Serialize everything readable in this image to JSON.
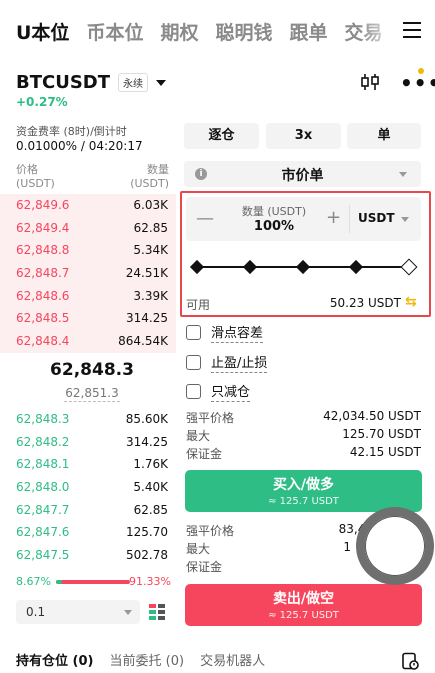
{
  "top_tabs": [
    "U本位",
    "币本位",
    "期权",
    "聪明钱",
    "跟单",
    "交易"
  ],
  "header": {
    "symbol": "BTCUSDT",
    "perp_tag": "永续",
    "change": "+0.27%"
  },
  "funding": {
    "label": "资金费率 (8时)/倒计时",
    "value": "0.01000% / 04:20:17"
  },
  "orderbook": {
    "col_price": "价格",
    "col_price_unit": "(USDT)",
    "col_qty": "数量",
    "col_qty_unit": "(USDT)",
    "asks": [
      {
        "price": "62,849.6",
        "qty": "6.03K"
      },
      {
        "price": "62,849.4",
        "qty": "62.85"
      },
      {
        "price": "62,848.8",
        "qty": "5.34K"
      },
      {
        "price": "62,848.7",
        "qty": "24.51K"
      },
      {
        "price": "62,848.6",
        "qty": "3.39K"
      },
      {
        "price": "62,848.5",
        "qty": "314.25"
      },
      {
        "price": "62,848.4",
        "qty": "864.54K"
      }
    ],
    "last_price": "62,848.3",
    "mark_price": "62,851.3",
    "bids": [
      {
        "price": "62,848.3",
        "qty": "85.60K"
      },
      {
        "price": "62,848.2",
        "qty": "314.25"
      },
      {
        "price": "62,848.1",
        "qty": "1.76K"
      },
      {
        "price": "62,848.0",
        "qty": "5.40K"
      },
      {
        "price": "62,847.7",
        "qty": "62.85"
      },
      {
        "price": "62,847.6",
        "qty": "125.70"
      },
      {
        "price": "62,847.5",
        "qty": "502.78"
      }
    ],
    "buy_ratio": "8.67%",
    "sell_ratio": "91.33%",
    "buy_ratio_value": 0.0867,
    "depth": "0.1"
  },
  "order_panel": {
    "margin_mode": "逐仓",
    "leverage": "3x",
    "position_mode": "单",
    "order_type": "市价单",
    "qty_label": "数量 (USDT)",
    "qty_value": "100%",
    "qty_unit": "USDT",
    "slider_percent": 100,
    "available_label": "可用",
    "available_value": "50.23 USDT",
    "options": [
      "滑点容差",
      "止盈/止损",
      "只减仓"
    ],
    "long_info": {
      "liq_label": "强平价格",
      "liq_value": "42,034.50 USDT",
      "max_label": "最大",
      "max_value": "125.70 USDT",
      "margin_label": "保证金",
      "margin_value": "42.15 USDT"
    },
    "buy_label": "买入/做多",
    "buy_sub": "≈ 125.7 USDT",
    "short_info": {
      "liq_label": "强平价格",
      "liq_value": "83,40",
      "max_label": "最大",
      "max_value": "1",
      "margin_label": "保证金",
      "margin_value": ""
    },
    "sell_label": "卖出/做空",
    "sell_sub": "≈ 125.7 USDT"
  },
  "bottom_tabs": [
    {
      "label": "持有仓位",
      "count": "(0)"
    },
    {
      "label": "当前委托",
      "count": "(0)"
    },
    {
      "label": "交易机器人",
      "count": ""
    }
  ],
  "colors": {
    "buy": "#2ebd85",
    "sell": "#f6465d",
    "accent": "#f0b90b",
    "highlight": "#e8474c"
  }
}
